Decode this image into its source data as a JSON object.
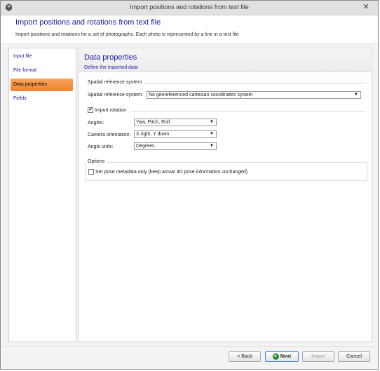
{
  "window": {
    "title": "Import positions and rotations from text file",
    "close_glyph": "✕"
  },
  "header": {
    "title": "Import positions and rotations from text file",
    "description": "Import positions and rotations for a set of photographs. Each photo is represented by a line in a text file"
  },
  "sidebar": {
    "items": [
      {
        "label": "Input file",
        "active": false
      },
      {
        "label": "File format",
        "active": false
      },
      {
        "label": "Data properties",
        "active": true
      },
      {
        "label": "Fields",
        "active": false
      }
    ]
  },
  "content": {
    "title": "Data properties",
    "subtitle": "Define the imported data",
    "srs_group": {
      "label": "Spatial reference system",
      "field_label": "Spatial reference system:",
      "value": "No georeferenced cartesian coordinates system"
    },
    "rotation_group": {
      "checkbox_label": "Import rotation",
      "checked": true,
      "check_glyph": "✔",
      "angles_label": "Angles:",
      "angles_value": "Yaw, Pitch, Roll",
      "camera_label": "Camera orientation:",
      "camera_value": "X right, Y down",
      "units_label": "Angle units:",
      "units_value": "Degrees"
    },
    "options_group": {
      "label": "Options",
      "checkbox_label": "Set pose metadata only (keep actual 3D pose information unchanged)",
      "checked": false
    }
  },
  "footer": {
    "back_label": "< Back",
    "next_label": "Next",
    "import_label": "Import",
    "cancel_label": "Cancel"
  },
  "icons": {
    "dropdown_arrow": "▼",
    "next_glyph": "►"
  }
}
